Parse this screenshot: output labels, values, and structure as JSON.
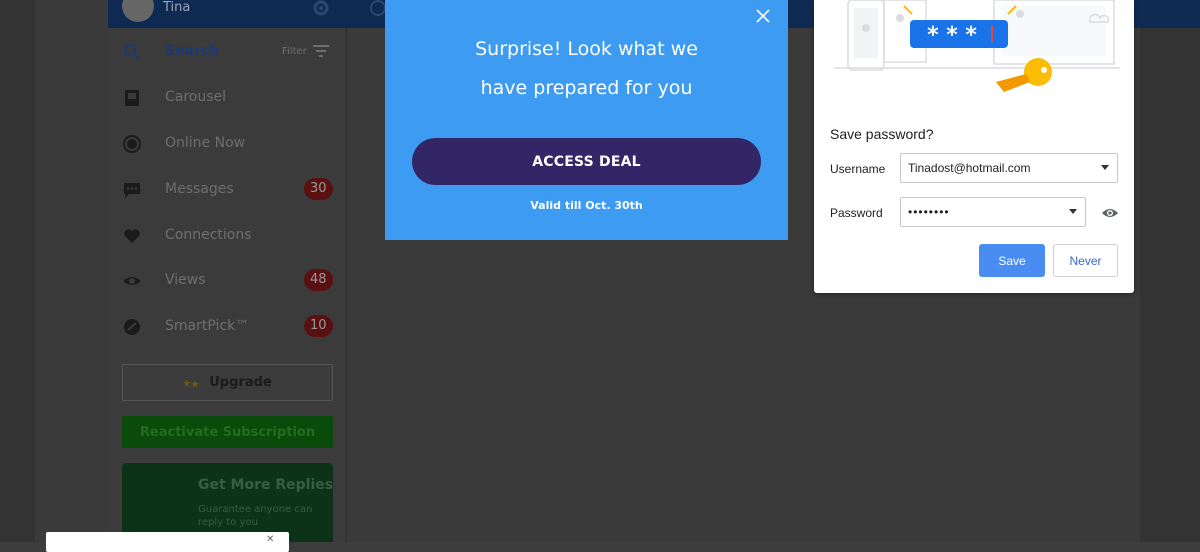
{
  "app": {
    "user_name": "Tina",
    "sidebar": {
      "search_label": "Search",
      "filter_label": "Filter",
      "items": [
        {
          "label": "Carousel",
          "icon": "carousel-icon",
          "badge": ""
        },
        {
          "label": "Online Now",
          "icon": "online-icon",
          "badge": ""
        },
        {
          "label": "Messages",
          "icon": "messages-icon",
          "badge": "30"
        },
        {
          "label": "Connections",
          "icon": "heart-icon",
          "badge": ""
        },
        {
          "label": "Views",
          "icon": "eye-icon",
          "badge": "48"
        },
        {
          "label": "SmartPick™",
          "icon": "smartpick-icon",
          "badge": "10"
        }
      ],
      "upgrade_label": "Upgrade",
      "reactivate_label": "Reactivate Subscription",
      "promo": {
        "title": "Get More Replies",
        "subtitle": "Guarantee anyone can reply to you"
      }
    }
  },
  "deal_modal": {
    "title_line1": "Surprise! Look what we",
    "title_line2": "have prepared for you",
    "button_label": "ACCESS DEAL",
    "valid_text": "Valid till Oct. 30th",
    "color": "#3d9bf2",
    "button_color": "#322667"
  },
  "password_dialog": {
    "title": "Save password?",
    "username_label": "Username",
    "username_value": "Tinadost@hotmail.com",
    "password_label": "Password",
    "password_value": "••••••••",
    "save_label": "Save",
    "never_label": "Never",
    "illustration_text": "* * *",
    "accent": "#4a8df2"
  },
  "colors": {
    "topbar": "#0f2a52",
    "badge": "#5a1010",
    "reactivate": "#0a4a0a"
  }
}
